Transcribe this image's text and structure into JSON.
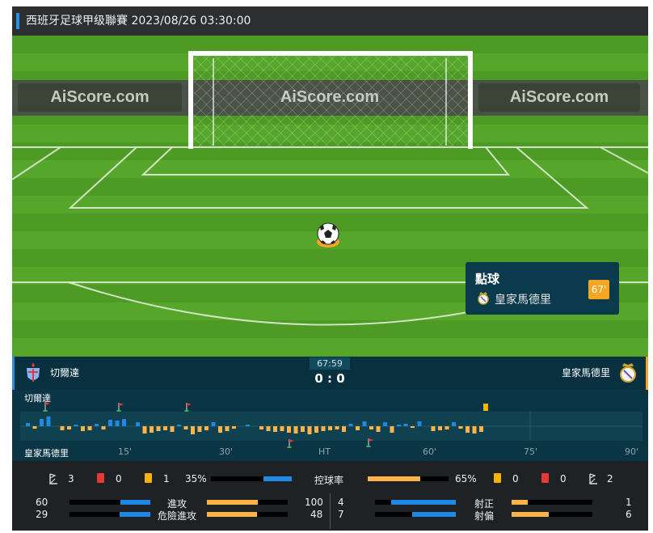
{
  "header": {
    "title": "西班牙足球甲级聯賽 2023/08/26 03:30:00"
  },
  "pitch": {
    "ad_text": "AiScore.com"
  },
  "event": {
    "title": "點球",
    "team": "皇家馬德里",
    "minute": "67'"
  },
  "scorebar": {
    "home": "切爾達",
    "away": "皇家馬德里",
    "clock": "67:59",
    "score": "0 : 0"
  },
  "timeline": {
    "home_label": "切爾達",
    "away_label": "皇家馬德里",
    "ticks": [
      "15'",
      "30'",
      "HT",
      "60'",
      "75'",
      "90'"
    ]
  },
  "stats": {
    "corners_home": "3",
    "red_home": "0",
    "yellow_home": "1",
    "possession_home": "35%",
    "possession_label": "控球率",
    "possession_away": "65%",
    "yellow_away": "0",
    "red_away": "0",
    "corners_away": "2",
    "attack_home": "60",
    "attack_label": "進攻",
    "attack_away": "100",
    "danger_home": "29",
    "danger_label": "危險進攻",
    "danger_away": "48",
    "ontarget_home": "4",
    "ontarget_label": "射正",
    "ontarget_away": "1",
    "offtarget_home": "7",
    "offtarget_label": "射偏",
    "offtarget_away": "6"
  },
  "colors": {
    "home": "#1e88e5",
    "away": "#ffb347",
    "red_card": "#e53935",
    "yellow_card": "#f5b400"
  }
}
